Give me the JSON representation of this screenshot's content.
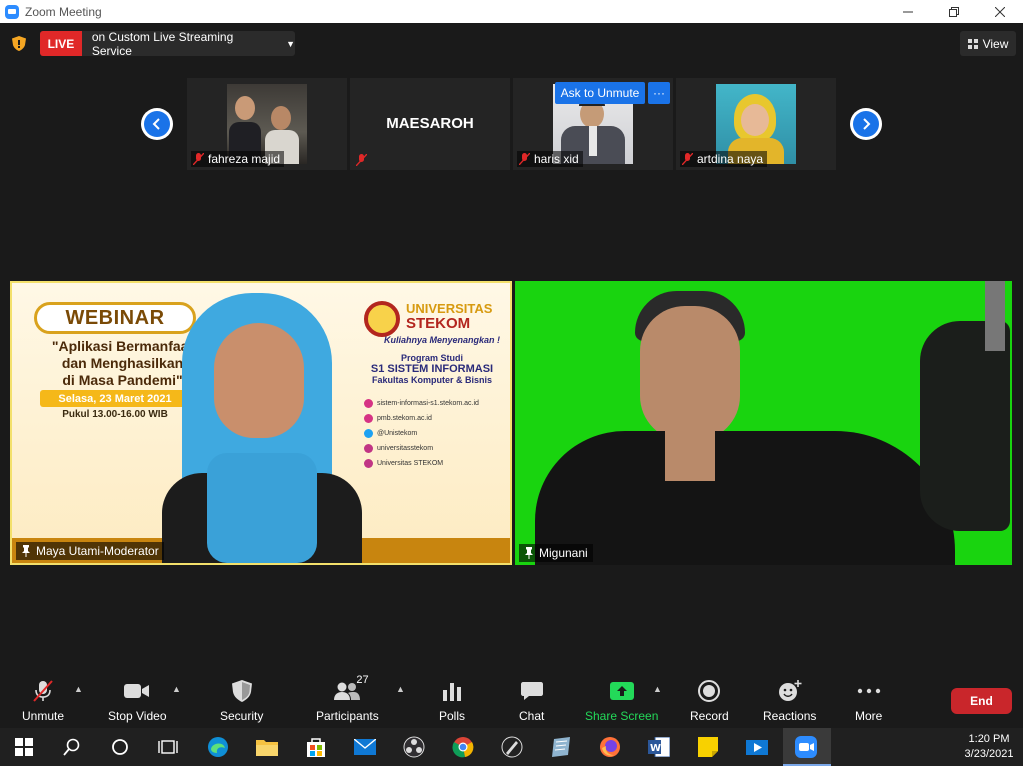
{
  "window": {
    "title": "Zoom Meeting",
    "controls": [
      "minimize",
      "maximize",
      "close"
    ]
  },
  "topbar": {
    "live_label": "LIVE",
    "streaming_text": "on Custom Live Streaming Service",
    "view_label": "View"
  },
  "gallery": {
    "tiles": [
      {
        "name": "fahreza majid",
        "muted": true
      },
      {
        "name": "MAESAROH",
        "muted": true
      },
      {
        "name": "haris xid",
        "muted": true
      },
      {
        "name": "artdina naya",
        "muted": true
      }
    ],
    "ask_to_unmute": "Ask to Unmute",
    "more": "···"
  },
  "main": {
    "left_speaker": "Maya Utami-Moderator",
    "right_speaker": "Migunani",
    "poster": {
      "badge": "WEBINAR",
      "headline_1": "\"Aplikasi Bermanfaat",
      "headline_2": "dan Menghasilkan",
      "headline_3": "di Masa Pandemi\"",
      "date": "Selasa, 23 Maret 2021",
      "time": "Pukul 13.00-16.00 WIB",
      "univ": "UNIVERSITAS",
      "stekom": "STEKOM",
      "tagline": "Kuliahnya Menyenangkan !",
      "prog_1": "Program Studi",
      "prog_2": "S1 SISTEM INFORMASI",
      "prog_3": "Fakultas Komputer & Bisnis",
      "contacts": [
        "sistem-informasi-s1.stekom.ac.id",
        "pmb.stekom.ac.id",
        "@Unistekom",
        "universitasstekom",
        "Universitas STEKOM"
      ]
    }
  },
  "toolbar": {
    "unmute": "Unmute",
    "stop_video": "Stop Video",
    "security": "Security",
    "participants": "Participants",
    "participants_count": "27",
    "polls": "Polls",
    "chat": "Chat",
    "share_screen": "Share Screen",
    "record": "Record",
    "reactions": "Reactions",
    "more": "More",
    "end": "End"
  },
  "taskbar": {
    "time": "1:20 PM",
    "date": "3/23/2021"
  },
  "colors": {
    "accent_blue": "#1a73e8",
    "live_red": "#e02828",
    "share_green": "#23d959",
    "end_red": "#c9262b",
    "active_speaker": "#f3e06b"
  }
}
